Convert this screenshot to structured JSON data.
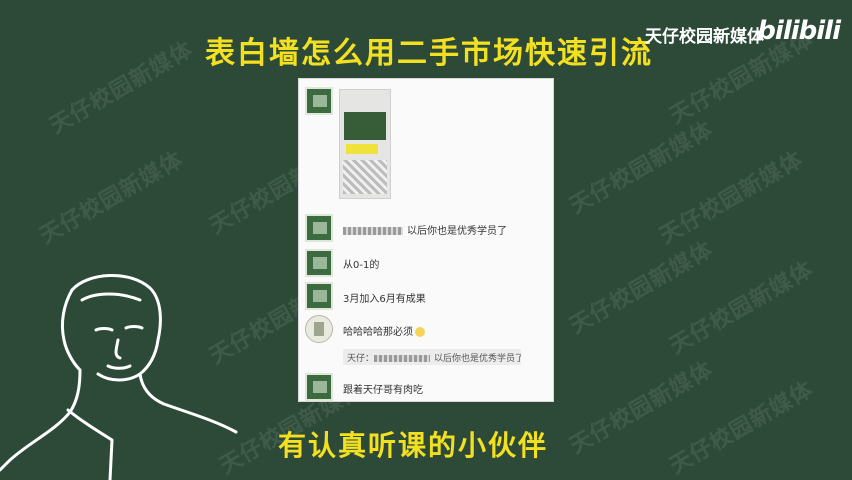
{
  "title": "表白墙怎么用二手市场快速引流",
  "brand": "天仔校园新媒体",
  "platform_logo": "bilibili",
  "watermark": "天仔校园新媒体",
  "chat": {
    "messages": [
      {
        "text": "以后你也是优秀学员了"
      },
      {
        "text": "从0-1的"
      },
      {
        "text": "3月加入6月有成果"
      },
      {
        "text": "哈哈哈哈那必须"
      },
      {
        "text": "跟着天仔哥有肉吃"
      }
    ],
    "quote": {
      "prefix": "天仔：",
      "text": "以后你也是优秀学员了"
    }
  },
  "subtitle": "有认真听课的小伙伴",
  "colors": {
    "background": "#2d4a38",
    "caption": "#f2e021"
  }
}
